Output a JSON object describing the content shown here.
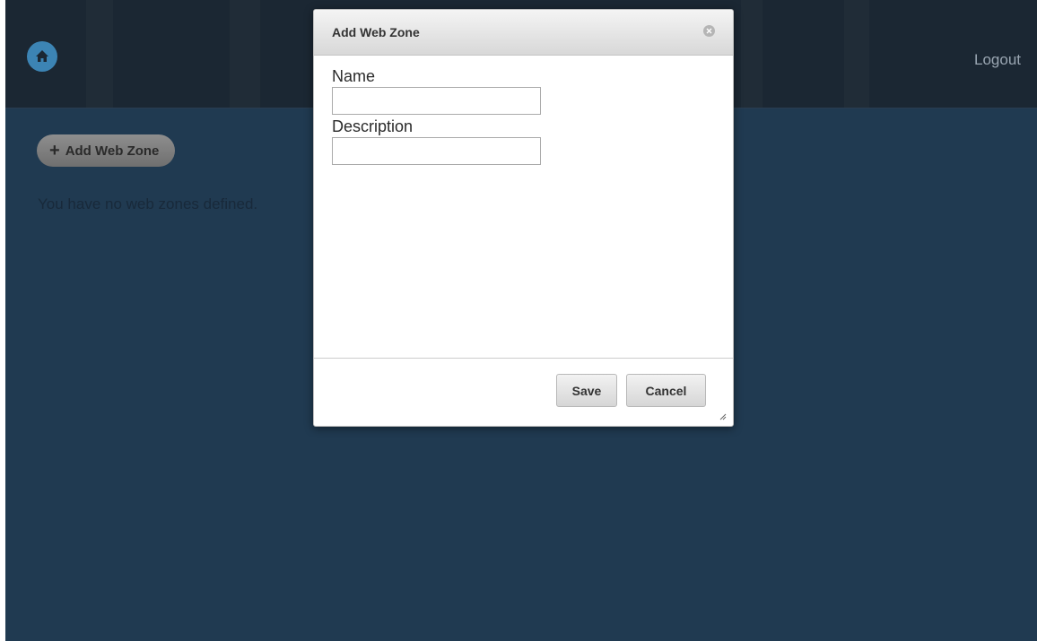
{
  "header": {
    "logout_label": "Logout",
    "home_icon": "home-icon"
  },
  "main": {
    "add_button_label": "Add Web Zone",
    "empty_message": "You have no web zones defined."
  },
  "dialog": {
    "title": "Add Web Zone",
    "fields": [
      {
        "label": "Name",
        "value": ""
      },
      {
        "label": "Description",
        "value": ""
      }
    ],
    "save_label": "Save",
    "cancel_label": "Cancel"
  },
  "colors": {
    "header_bg": "#1b2733",
    "content_bg": "#203a51",
    "home_accent": "#3c84b4"
  }
}
